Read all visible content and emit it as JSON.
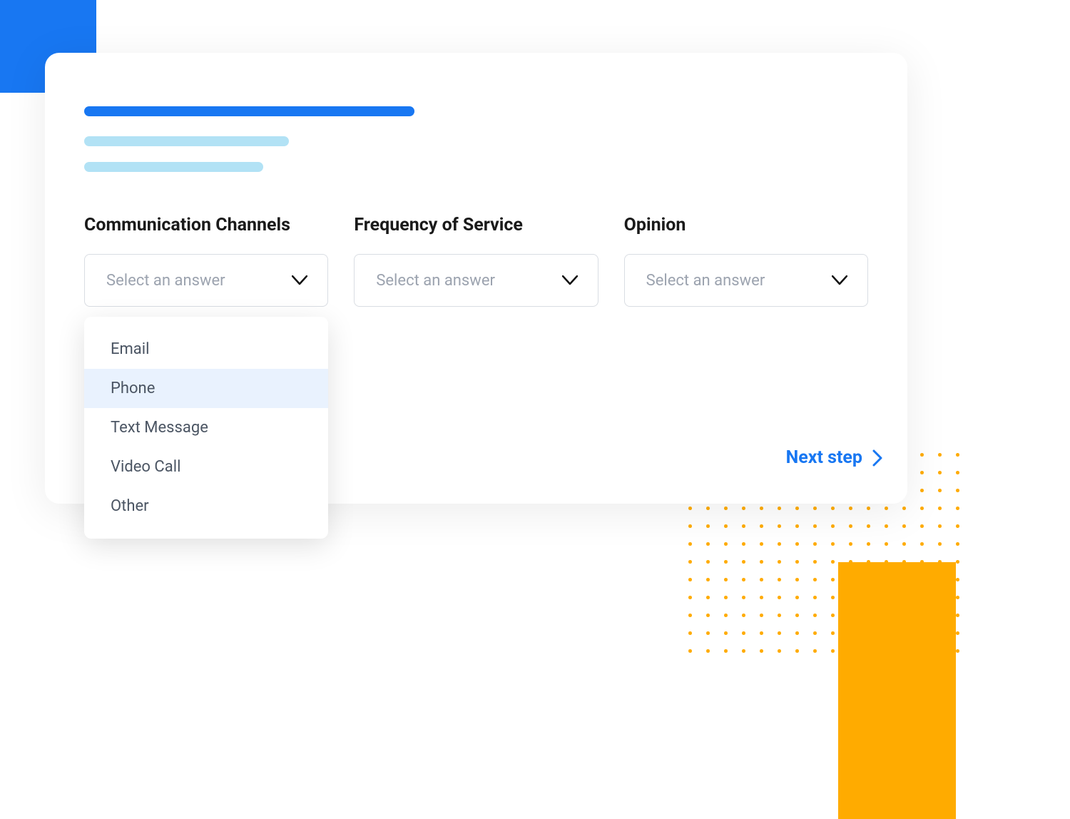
{
  "colors": {
    "primary_blue": "#1877F2",
    "light_blue": "#B2E2F5",
    "orange": "#FFAB00",
    "placeholder_text": "#9CA3AF",
    "border": "#D9DDE3",
    "highlight_bg": "#E9F2FE",
    "text_dark": "#1a1a1a",
    "text_medium": "#4B5563"
  },
  "fields": [
    {
      "label": "Communication Channels",
      "placeholder": "Select an answer",
      "expanded": true,
      "options": [
        {
          "label": "Email",
          "highlighted": false
        },
        {
          "label": "Phone",
          "highlighted": true
        },
        {
          "label": "Text Message",
          "highlighted": false
        },
        {
          "label": "Video Call",
          "highlighted": false
        },
        {
          "label": "Other",
          "highlighted": false
        }
      ]
    },
    {
      "label": "Frequency of Service",
      "placeholder": "Select an answer",
      "expanded": false,
      "options": []
    },
    {
      "label": "Opinion",
      "placeholder": "Select an answer",
      "expanded": false,
      "options": []
    }
  ],
  "next_step_label": "Next step"
}
